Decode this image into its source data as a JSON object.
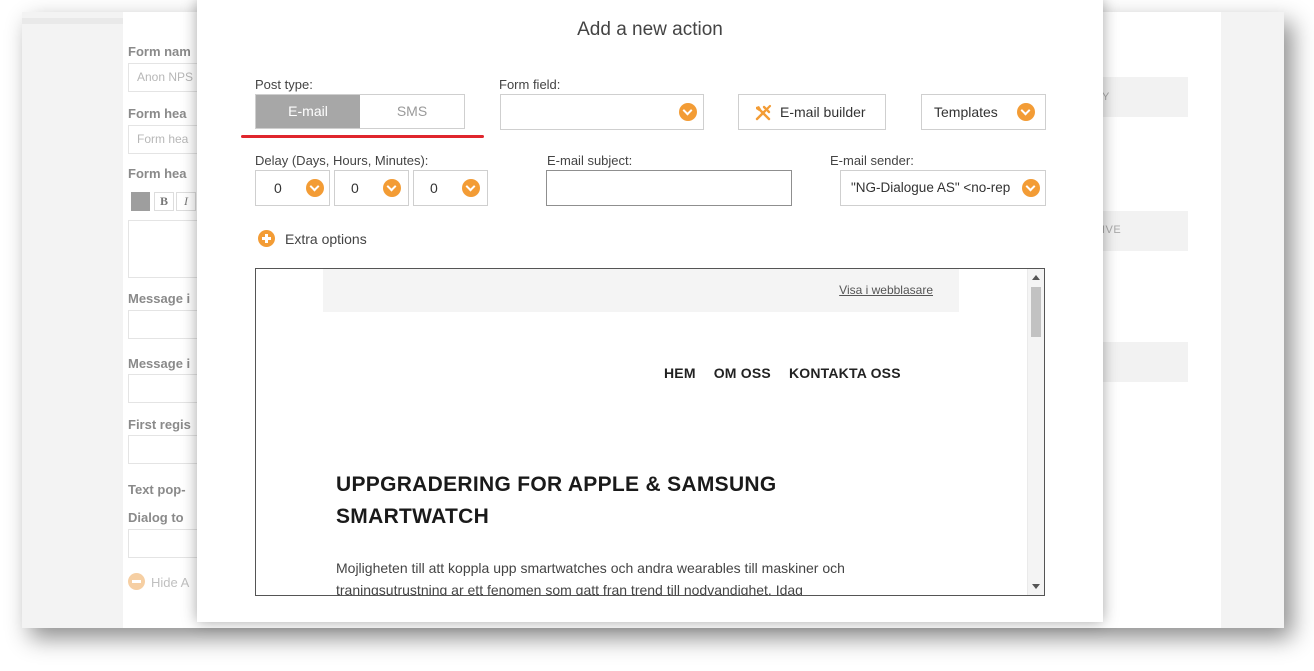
{
  "background": {
    "labels": [
      "Form nam",
      "Form hea",
      "Form hea",
      "Message i",
      "Message i",
      "First regis",
      "Text pop-",
      "Dialog to"
    ],
    "inputs": [
      "Anon NPS",
      "Form hea"
    ],
    "toolbar": {
      "bold": "B",
      "italic": "I"
    },
    "hide_link": "Hide A",
    "right_labels": [
      "Y",
      "IVE"
    ]
  },
  "modal": {
    "title": "Add a new action",
    "post_type": {
      "label": "Post type:",
      "options": [
        "E-mail",
        "SMS"
      ],
      "selected": "E-mail"
    },
    "form_field": {
      "label": "Form field:",
      "value": ""
    },
    "email_builder_label": "E-mail builder",
    "templates_label": "Templates",
    "delay": {
      "label": "Delay (Days, Hours, Minutes):",
      "days": "0",
      "hours": "0",
      "minutes": "0"
    },
    "email_subject": {
      "label": "E-mail subject:",
      "value": ""
    },
    "email_sender": {
      "label": "E-mail sender:",
      "value": "\"NG-Dialogue AS\" <no-rep"
    },
    "extra_options": "Extra options",
    "preview": {
      "view_in_browser": "Visa i webblasare",
      "nav": [
        "HEM",
        "OM OSS",
        "KONTAKTA OSS"
      ],
      "heading": "UPPGRADERING FOR APPLE & SAMSUNG SMARTWATCH",
      "paragraph": "Mojligheten till att koppla upp smartwatches och andra wearables till maskiner och traningsutrustning ar ett fenomen som gatt fran trend till nodvandighet. Idag"
    }
  },
  "colors": {
    "accent": "#f39c35",
    "selected_toggle": "#a7a7a7",
    "underline": "#e0262d"
  },
  "icons": {
    "builder": "tools-icon",
    "dropdown": "chevron-down-icon",
    "extra": "plus-circle-icon"
  }
}
